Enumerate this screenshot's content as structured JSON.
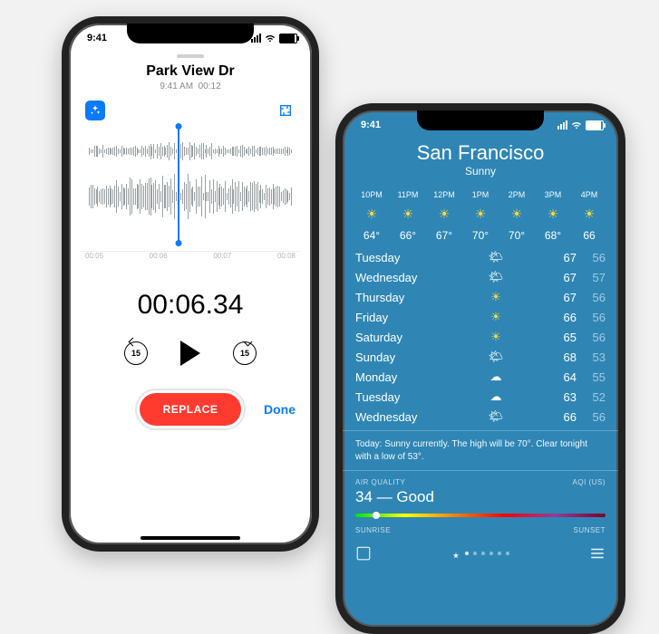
{
  "voice": {
    "status_time": "9:41",
    "title": "Park View Dr",
    "subtitle_time": "9:41 AM",
    "subtitle_dur": "00:12",
    "ruler": [
      "00:05",
      "00:06",
      "00:07",
      "00:08"
    ],
    "timer": "00:06.34",
    "skip_back": "15",
    "skip_fwd": "15",
    "replace_label": "REPLACE",
    "done_label": "Done"
  },
  "weather": {
    "status_time": "9:41",
    "city": "San Francisco",
    "condition": "Sunny",
    "hourly": [
      {
        "label": "10PM",
        "icon": "sun",
        "temp": "64°"
      },
      {
        "label": "11PM",
        "icon": "sun",
        "temp": "66°"
      },
      {
        "label": "12PM",
        "icon": "sun",
        "temp": "67°"
      },
      {
        "label": "1PM",
        "icon": "sun",
        "temp": "70°"
      },
      {
        "label": "2PM",
        "icon": "sun",
        "temp": "70°"
      },
      {
        "label": "3PM",
        "icon": "sun",
        "temp": "68°"
      },
      {
        "label": "4PM",
        "icon": "sun",
        "temp": "66"
      }
    ],
    "daily": [
      {
        "day": "Tuesday",
        "icon": "partly",
        "hi": "67",
        "lo": "56"
      },
      {
        "day": "Wednesday",
        "icon": "partly",
        "hi": "67",
        "lo": "57"
      },
      {
        "day": "Thursday",
        "icon": "sun",
        "hi": "67",
        "lo": "56"
      },
      {
        "day": "Friday",
        "icon": "sun",
        "hi": "66",
        "lo": "56"
      },
      {
        "day": "Saturday",
        "icon": "sun",
        "hi": "65",
        "lo": "56"
      },
      {
        "day": "Sunday",
        "icon": "partly",
        "hi": "68",
        "lo": "53"
      },
      {
        "day": "Monday",
        "icon": "cloud",
        "hi": "64",
        "lo": "55"
      },
      {
        "day": "Tuesday",
        "icon": "cloud",
        "hi": "63",
        "lo": "52"
      },
      {
        "day": "Wednesday",
        "icon": "partly",
        "hi": "66",
        "lo": "56"
      }
    ],
    "today_text": "Today: Sunny currently. The high will be 70°. Clear tonight with a low of 53°.",
    "aq_label_left": "AIR QUALITY",
    "aq_label_right": "AQI (US)",
    "aq_value": "34 — Good",
    "sunrise_label": "SUNRISE",
    "sunset_label": "SUNSET"
  }
}
